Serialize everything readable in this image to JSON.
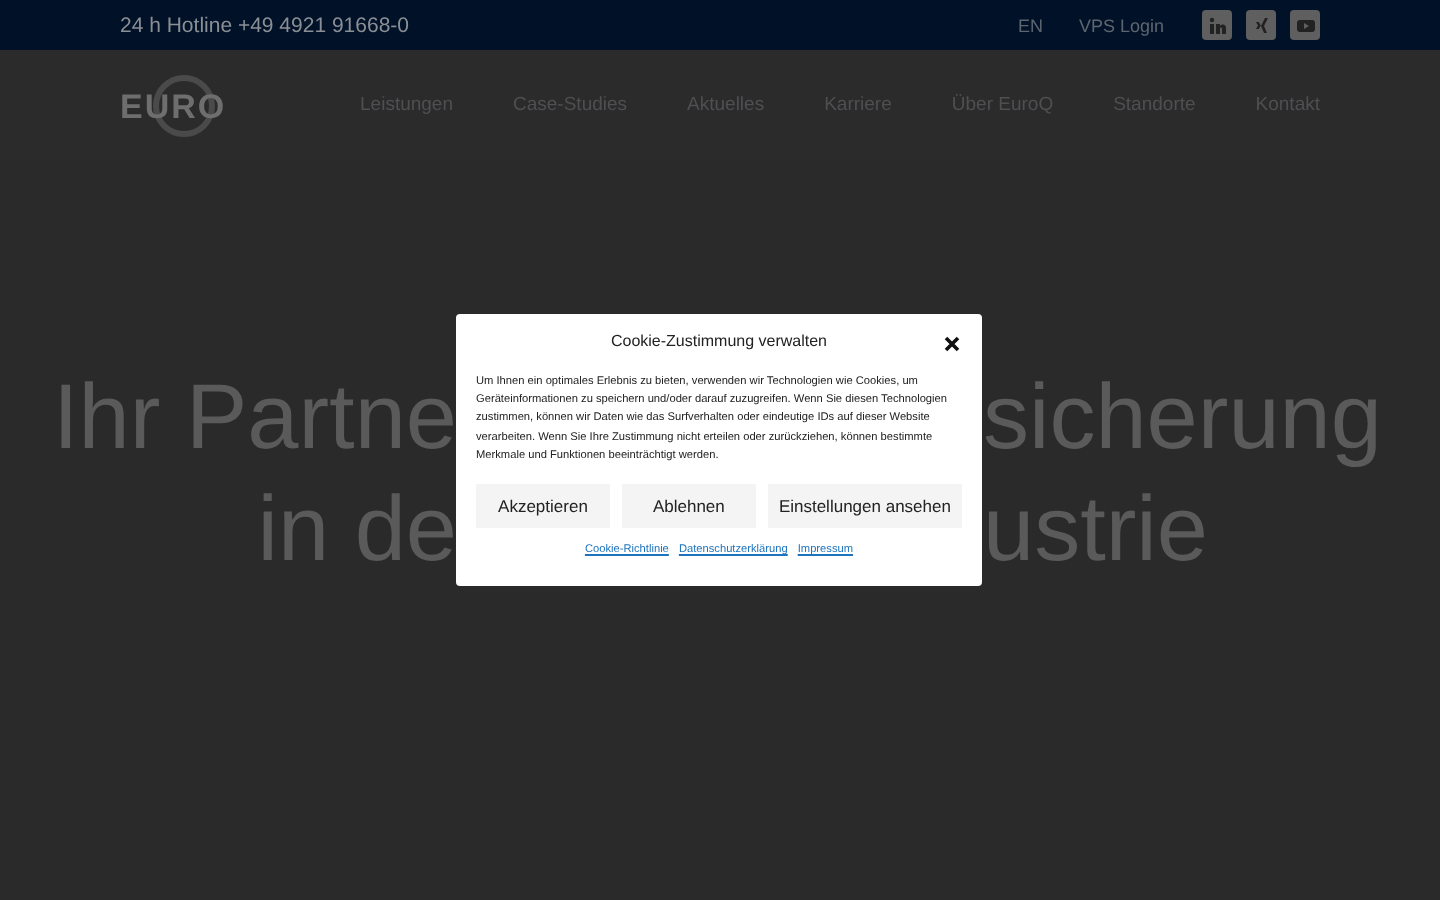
{
  "topbar": {
    "hotline": "24 h Hotline +49 4921 91668-0",
    "language": "EN",
    "login": "VPS Login",
    "social": [
      {
        "kind": "linkedin"
      },
      {
        "kind": "xing"
      },
      {
        "kind": "youtube"
      }
    ]
  },
  "header": {
    "logo": "EURO",
    "nav": [
      "Leistungen",
      "Case-Studies",
      "Aktuelles",
      "Karriere",
      "Über EuroQ",
      "Standorte",
      "Kontakt"
    ]
  },
  "hero": {
    "lines": [
      {
        "left": "Ihr Partne",
        "right": "sicherung"
      },
      {
        "left": "in de",
        "right": "ustrie"
      }
    ]
  },
  "cookie_dialog": {
    "title": "Cookie-Zustimmung verwalten",
    "text": "Um Ihnen ein optimales Erlebnis zu bieten, verwenden wir Technologien wie Cookies, um Geräteinformationen zu speichern und/oder darauf zuzugreifen. Wenn Sie diesen Technologien zustimmen, können wir Daten wie das Surfverhalten oder eindeutige IDs auf dieser Website verarbeiten. Wenn Sie Ihre Zustimmung nicht erteilen oder zurückziehen, können bestimmte Merkmale und Funktionen beeinträchtigt werden.",
    "buttons": [
      "Akzeptieren",
      "Ablehnen",
      "Einstellungen ansehen"
    ],
    "links": [
      "Cookie-Richtlinie",
      "Datenschutzerklärung",
      "Impressum"
    ]
  }
}
